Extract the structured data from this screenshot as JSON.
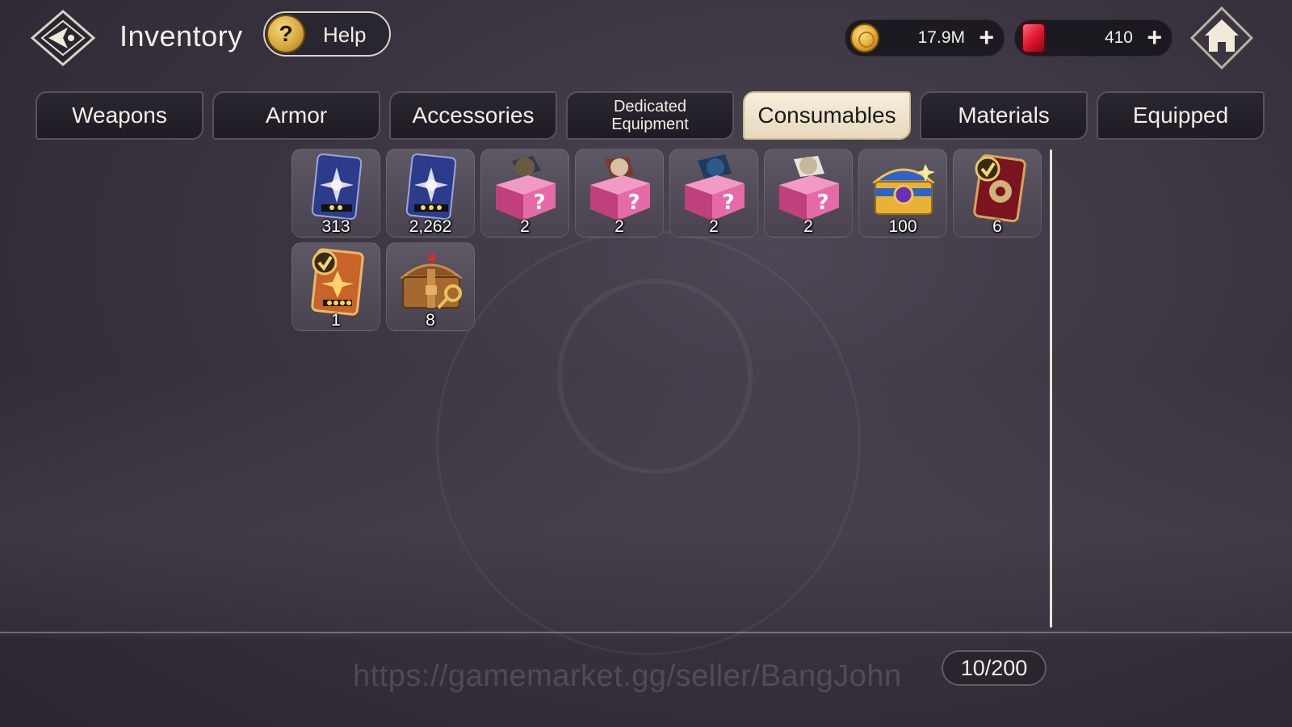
{
  "header": {
    "title": "Inventory",
    "help_label": "Help",
    "help_icon_glyph": "?"
  },
  "currencies": {
    "gold": {
      "value": "17.9M",
      "icon": "gold-coin-icon",
      "plus": "+"
    },
    "gems": {
      "value": "410",
      "icon": "red-gem-icon",
      "plus": "+"
    }
  },
  "tabs": [
    {
      "label": "Weapons",
      "active": false
    },
    {
      "label": "Armor",
      "active": false
    },
    {
      "label": "Accessories",
      "active": false
    },
    {
      "label": "Dedicated\nEquipment",
      "active": false
    },
    {
      "label": "Consumables",
      "active": true
    },
    {
      "label": "Materials",
      "active": false
    },
    {
      "label": "Equipped",
      "active": false
    }
  ],
  "items": [
    {
      "count": "313",
      "icon": "blue-card-2star-icon"
    },
    {
      "count": "2,262",
      "icon": "blue-card-3star-icon"
    },
    {
      "count": "2",
      "icon": "mystery-box-dark-icon"
    },
    {
      "count": "2",
      "icon": "mystery-box-red-icon"
    },
    {
      "count": "2",
      "icon": "mystery-box-blue-icon"
    },
    {
      "count": "2",
      "icon": "mystery-box-white-icon"
    },
    {
      "count": "100",
      "icon": "gold-blue-chest-icon"
    },
    {
      "count": "6",
      "icon": "red-selection-card-icon"
    },
    {
      "count": "1",
      "icon": "orange-selection-card-icon"
    },
    {
      "count": "8",
      "icon": "wooden-key-chest-icon"
    }
  ],
  "footer": {
    "watermark": "https://gamemarket.gg/seller/BangJohn",
    "slot_counter": "10/200"
  },
  "colors": {
    "active_tab": "#f2e8d0",
    "inactive_tab": "#221f27",
    "gold": "#e2a932",
    "gem": "#e0182e"
  }
}
